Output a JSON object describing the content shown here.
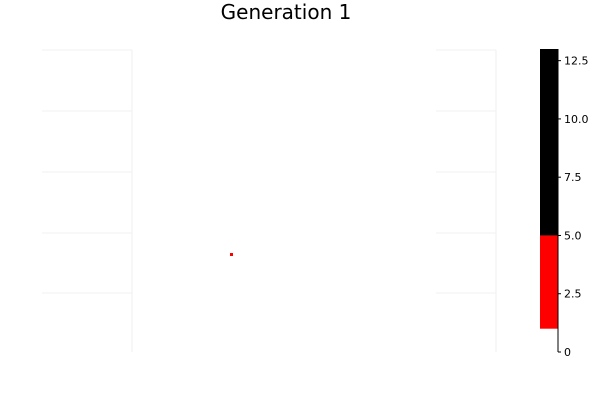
{
  "chart_data": {
    "type": "heatmap",
    "title": "Generation 1",
    "xlabel": "",
    "ylabel": "",
    "grid": true,
    "legend": "none",
    "colorbar": {
      "range": [
        0,
        13
      ],
      "ticks": [
        {
          "value": 0,
          "label": "0"
        },
        {
          "value": 2.5,
          "label": "2.5"
        },
        {
          "value": 5,
          "label": "5.0"
        },
        {
          "value": 7.5,
          "label": "7.5"
        },
        {
          "value": 10,
          "label": "10.0"
        },
        {
          "value": 12.5,
          "label": "12.5"
        }
      ],
      "bands": [
        {
          "from": 1,
          "to": 5,
          "color": "#ff0000"
        },
        {
          "from": 5,
          "to": 13,
          "color": "#000000"
        }
      ]
    },
    "cells": [
      {
        "value": 5,
        "color": "#ff0000"
      }
    ]
  }
}
